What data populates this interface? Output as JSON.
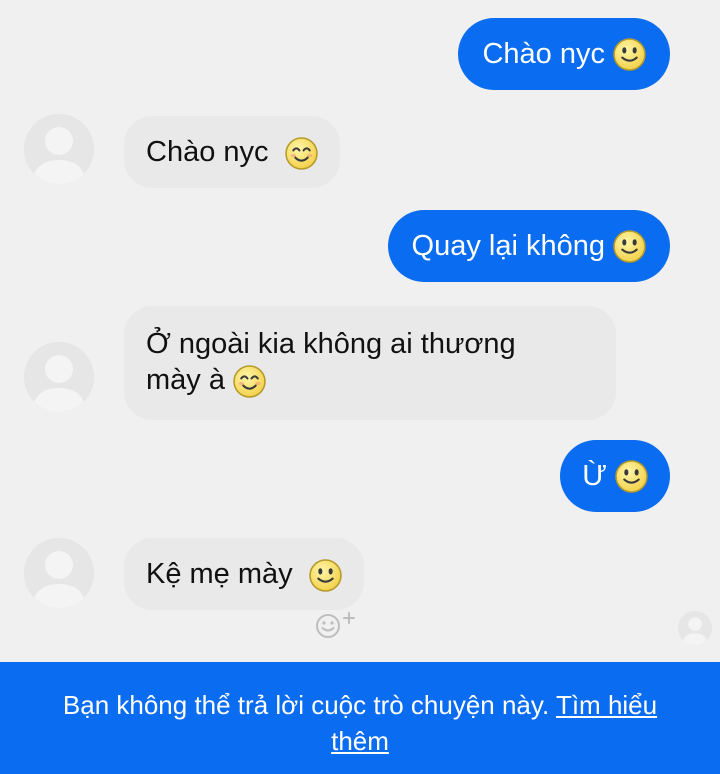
{
  "messages": [
    {
      "direction": "outgoing",
      "text": "Chào nyc",
      "emoji": "slightly-smiling-emoji"
    },
    {
      "direction": "incoming",
      "text": "Chào nyc",
      "emoji": "smiling-eyes-emoji"
    },
    {
      "direction": "outgoing",
      "text": "Quay lại không",
      "emoji": "slightly-smiling-emoji"
    },
    {
      "direction": "incoming",
      "text_line1": "Ở ngoài kia không ai thương",
      "text_line2": "mày à",
      "emoji": "smiling-eyes-emoji"
    },
    {
      "direction": "outgoing",
      "text": "Ừ",
      "emoji": "slightly-smiling-emoji"
    },
    {
      "direction": "incoming",
      "text": "Kệ mẹ mày",
      "emoji": "slightly-smiling-emoji"
    }
  ],
  "banner": {
    "text": "Bạn không thể trả lời cuộc trò chuyện này.",
    "link_label": "Tìm hiểu thêm"
  },
  "colors": {
    "outgoing_bubble": "#0a6cf0",
    "incoming_bubble": "#e9e9e9",
    "background": "#f0f0f0",
    "banner": "#0a6cf0"
  }
}
